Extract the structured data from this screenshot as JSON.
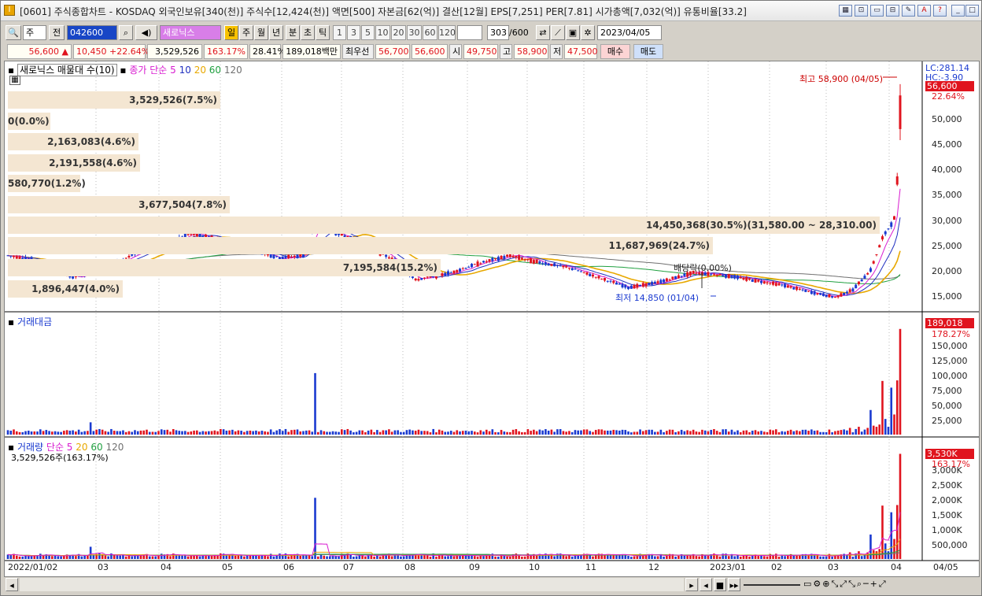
{
  "title_bar": {
    "text": "[0601] 주식종합차트 - KOSDAQ 외국인보유[340(천)] 주식수[12,424(천)] 액면[500] 자본금[62(억)] 결산[12월] EPS[7,251] PER[7.81] 시가총액[7,032(억)] 유통비율[33.2]",
    "app_icon": "I",
    "icons": [
      "layout-icon",
      "lock-icon",
      "window-icon",
      "link-icon",
      "memo-icon",
      "font-icon",
      "help-icon",
      "minimize-icon",
      "maximize-icon",
      "close-icon"
    ]
  },
  "toolbar": {
    "type": "주",
    "type2": "전",
    "code": "042600",
    "stock_name": "새로닉스",
    "periods_active": "일",
    "periods": [
      "주",
      "월",
      "년",
      "분",
      "초",
      "틱"
    ],
    "intervals": [
      "1",
      "3",
      "5",
      "10",
      "20",
      "30",
      "60",
      "120"
    ],
    "count": "303",
    "count_max": "/600",
    "date": "2023/04/05"
  },
  "quote": {
    "price": "56,600",
    "change": "10,450",
    "rate": "+22.64%",
    "volume": "3,529,526",
    "vol_ratio": "163.17%",
    "turnover": "28.41%",
    "amount": "189,018백만",
    "best_label": "최우선",
    "ask": "56,700",
    "bid": "56,600",
    "open_label": "시",
    "open": "49,750",
    "high_label": "고",
    "high": "58,900",
    "low_label": "저",
    "low": "47,500",
    "buy": "매수",
    "sell": "매도"
  },
  "price_panel": {
    "legend_name": "새로닉스 매물대 수(10)",
    "ma_label": "종가 단순 5",
    "ma_periods": [
      "10",
      "20",
      "60",
      "120"
    ],
    "lc": "LC:281.14",
    "hc": "HC:-3.90",
    "last": "56,600",
    "last_pct": "22.64%",
    "high_annot": "최고 58,900 (04/05)",
    "low_annot": "최저 14,850 (01/04)",
    "div_annot": "배당락(0.00%)",
    "vp_labels": [
      "3,529,526(7.5%)",
      "0(0.0%)",
      "2,163,083(4.6%)",
      "2,191,558(4.6%)",
      "580,770(1.2%)",
      "3,677,504(7.8%)",
      "14,450,368(30.5%)(31,580.00 ~ 28,310.00)",
      "11,687,969(24.7%)",
      "7,195,584(15.2%)",
      "1,896,447(4.0%)"
    ],
    "y_ticks": [
      "50,000",
      "45,000",
      "40,000",
      "35,000",
      "30,000",
      "25,000",
      "20,000",
      "15,000"
    ]
  },
  "amount_panel": {
    "title": "거래대금",
    "last": "189,018",
    "last_pct": "178.27%",
    "y_ticks": [
      "150,000",
      "125,000",
      "100,000",
      "75,000",
      "50,000",
      "25,000"
    ]
  },
  "volume_panel": {
    "title": "거래량",
    "ma_label": "단순 5",
    "ma_periods": [
      "20",
      "60",
      "120"
    ],
    "sub": "3,529,526주(163.17%)",
    "last": "3,530K",
    "last_pct": "163.17%",
    "y_ticks": [
      "3,000K",
      "2,500K",
      "2,000K",
      "1,500K",
      "1,000K",
      "500,000"
    ]
  },
  "x_axis": [
    "2022/01/02",
    "03",
    "04",
    "05",
    "06",
    "07",
    "08",
    "09",
    "10",
    "11",
    "12",
    "2023/01",
    "02",
    "03",
    "04",
    "04/05"
  ],
  "colors": {
    "up": "#e0141e",
    "down": "#1a3ad0",
    "ma5": "#d81bd0",
    "ma10": "#2030c0",
    "ma20": "#e8a800",
    "ma60": "#20a040",
    "ma120": "#707070",
    "vp": "#f4e6d2"
  },
  "chart_data": {
    "type": "candlestick",
    "ylim": [
      13500,
      60000
    ],
    "close_markers": {
      "high": 58900,
      "low": 14850,
      "last": 56600
    }
  }
}
